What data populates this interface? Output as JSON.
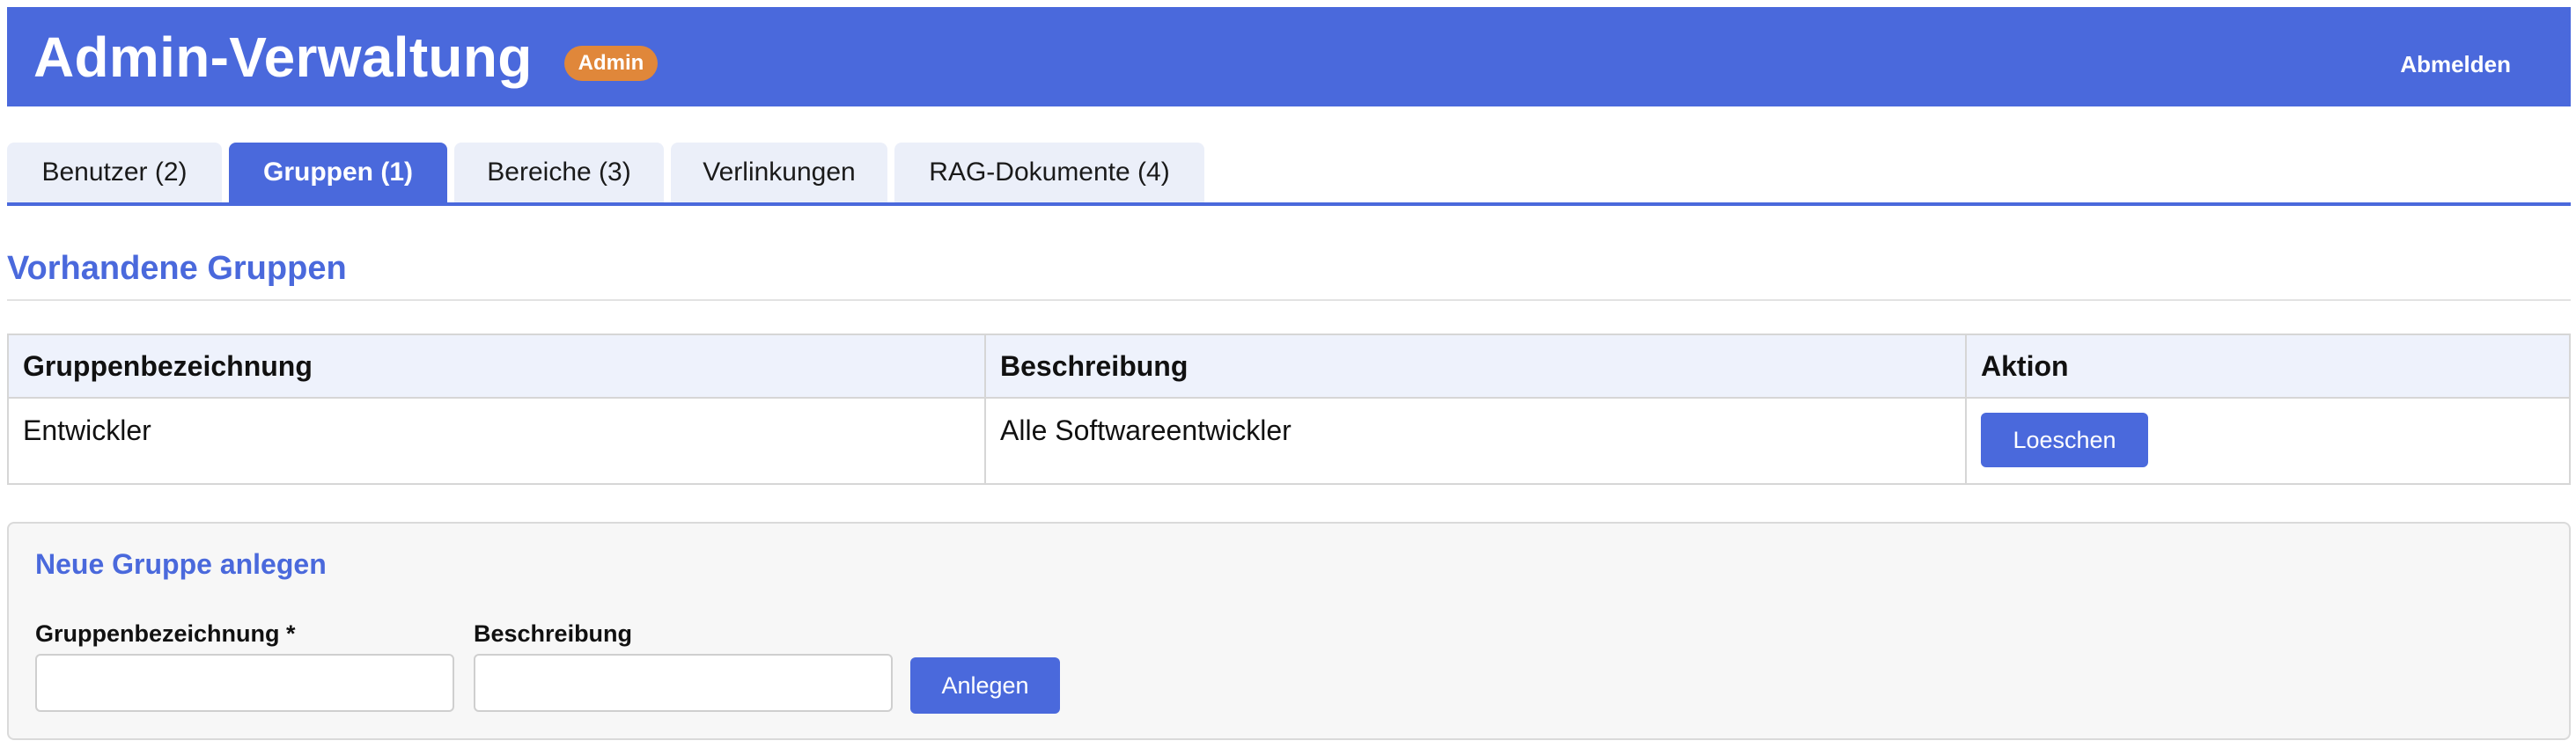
{
  "header": {
    "title": "Admin-Verwaltung",
    "role_badge": "Admin",
    "logout_label": "Abmelden"
  },
  "tabs": [
    {
      "label": "Benutzer (2)",
      "active": false
    },
    {
      "label": "Gruppen (1)",
      "active": true
    },
    {
      "label": "Bereiche (3)",
      "active": false
    },
    {
      "label": "Verlinkungen",
      "active": false
    },
    {
      "label": "RAG-Dokumente (4)",
      "active": false
    }
  ],
  "groups_section": {
    "title": "Vorhandene Gruppen",
    "columns": [
      "Gruppenbezeichnung",
      "Beschreibung",
      "Aktion"
    ],
    "rows": [
      {
        "name": "Entwickler",
        "description": "Alle Softwareentwickler",
        "action_label": "Loeschen"
      }
    ]
  },
  "new_group_form": {
    "title": "Neue Gruppe anlegen",
    "name_label": "Gruppenbezeichnung *",
    "name_value": "",
    "description_label": "Beschreibung",
    "description_value": "",
    "submit_label": "Anlegen"
  },
  "colors": {
    "primary": "#4a69dc",
    "badge": "#e0873a",
    "tab_inactive": "#ebeff9",
    "table_header": "#eef2fc",
    "form_background": "#f7f7f7"
  }
}
